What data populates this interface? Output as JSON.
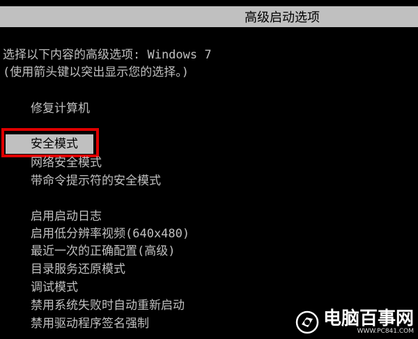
{
  "header": {
    "title": "高级启动选项"
  },
  "intro": {
    "line1": "选择以下内容的高级选项: Windows 7",
    "line2": "(使用箭头键以突出显示您的选择。)"
  },
  "menu": {
    "selected_index": 1,
    "items": [
      "修复计算机",
      "安全模式",
      "网络安全模式",
      "带命令提示符的安全模式",
      "启用启动日志",
      "启用低分辨率视频(640x480)",
      "最近一次的正确配置(高级)",
      "目录服务还原模式",
      "调试模式",
      "禁用系统失败时自动重新启动",
      "禁用驱动程序签名强制"
    ]
  },
  "highlight_color": "#e00000",
  "watermark": {
    "name": "电脑百事网",
    "url": "WWW.PC841.COM"
  }
}
